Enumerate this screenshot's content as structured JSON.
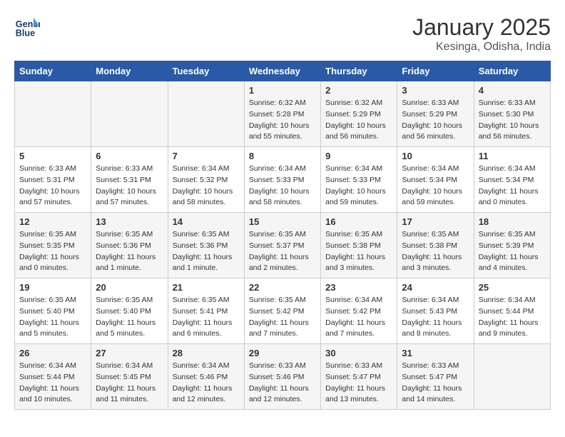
{
  "header": {
    "logo_line1": "General",
    "logo_line2": "Blue",
    "title": "January 2025",
    "subtitle": "Kesinga, Odisha, India"
  },
  "weekdays": [
    "Sunday",
    "Monday",
    "Tuesday",
    "Wednesday",
    "Thursday",
    "Friday",
    "Saturday"
  ],
  "weeks": [
    [
      {
        "day": "",
        "sunrise": "",
        "sunset": "",
        "daylight": ""
      },
      {
        "day": "",
        "sunrise": "",
        "sunset": "",
        "daylight": ""
      },
      {
        "day": "",
        "sunrise": "",
        "sunset": "",
        "daylight": ""
      },
      {
        "day": "1",
        "sunrise": "Sunrise: 6:32 AM",
        "sunset": "Sunset: 5:28 PM",
        "daylight": "Daylight: 10 hours and 55 minutes."
      },
      {
        "day": "2",
        "sunrise": "Sunrise: 6:32 AM",
        "sunset": "Sunset: 5:29 PM",
        "daylight": "Daylight: 10 hours and 56 minutes."
      },
      {
        "day": "3",
        "sunrise": "Sunrise: 6:33 AM",
        "sunset": "Sunset: 5:29 PM",
        "daylight": "Daylight: 10 hours and 56 minutes."
      },
      {
        "day": "4",
        "sunrise": "Sunrise: 6:33 AM",
        "sunset": "Sunset: 5:30 PM",
        "daylight": "Daylight: 10 hours and 56 minutes."
      }
    ],
    [
      {
        "day": "5",
        "sunrise": "Sunrise: 6:33 AM",
        "sunset": "Sunset: 5:31 PM",
        "daylight": "Daylight: 10 hours and 57 minutes."
      },
      {
        "day": "6",
        "sunrise": "Sunrise: 6:33 AM",
        "sunset": "Sunset: 5:31 PM",
        "daylight": "Daylight: 10 hours and 57 minutes."
      },
      {
        "day": "7",
        "sunrise": "Sunrise: 6:34 AM",
        "sunset": "Sunset: 5:32 PM",
        "daylight": "Daylight: 10 hours and 58 minutes."
      },
      {
        "day": "8",
        "sunrise": "Sunrise: 6:34 AM",
        "sunset": "Sunset: 5:33 PM",
        "daylight": "Daylight: 10 hours and 58 minutes."
      },
      {
        "day": "9",
        "sunrise": "Sunrise: 6:34 AM",
        "sunset": "Sunset: 5:33 PM",
        "daylight": "Daylight: 10 hours and 59 minutes."
      },
      {
        "day": "10",
        "sunrise": "Sunrise: 6:34 AM",
        "sunset": "Sunset: 5:34 PM",
        "daylight": "Daylight: 10 hours and 59 minutes."
      },
      {
        "day": "11",
        "sunrise": "Sunrise: 6:34 AM",
        "sunset": "Sunset: 5:34 PM",
        "daylight": "Daylight: 11 hours and 0 minutes."
      }
    ],
    [
      {
        "day": "12",
        "sunrise": "Sunrise: 6:35 AM",
        "sunset": "Sunset: 5:35 PM",
        "daylight": "Daylight: 11 hours and 0 minutes."
      },
      {
        "day": "13",
        "sunrise": "Sunrise: 6:35 AM",
        "sunset": "Sunset: 5:36 PM",
        "daylight": "Daylight: 11 hours and 1 minute."
      },
      {
        "day": "14",
        "sunrise": "Sunrise: 6:35 AM",
        "sunset": "Sunset: 5:36 PM",
        "daylight": "Daylight: 11 hours and 1 minute."
      },
      {
        "day": "15",
        "sunrise": "Sunrise: 6:35 AM",
        "sunset": "Sunset: 5:37 PM",
        "daylight": "Daylight: 11 hours and 2 minutes."
      },
      {
        "day": "16",
        "sunrise": "Sunrise: 6:35 AM",
        "sunset": "Sunset: 5:38 PM",
        "daylight": "Daylight: 11 hours and 3 minutes."
      },
      {
        "day": "17",
        "sunrise": "Sunrise: 6:35 AM",
        "sunset": "Sunset: 5:38 PM",
        "daylight": "Daylight: 11 hours and 3 minutes."
      },
      {
        "day": "18",
        "sunrise": "Sunrise: 6:35 AM",
        "sunset": "Sunset: 5:39 PM",
        "daylight": "Daylight: 11 hours and 4 minutes."
      }
    ],
    [
      {
        "day": "19",
        "sunrise": "Sunrise: 6:35 AM",
        "sunset": "Sunset: 5:40 PM",
        "daylight": "Daylight: 11 hours and 5 minutes."
      },
      {
        "day": "20",
        "sunrise": "Sunrise: 6:35 AM",
        "sunset": "Sunset: 5:40 PM",
        "daylight": "Daylight: 11 hours and 5 minutes."
      },
      {
        "day": "21",
        "sunrise": "Sunrise: 6:35 AM",
        "sunset": "Sunset: 5:41 PM",
        "daylight": "Daylight: 11 hours and 6 minutes."
      },
      {
        "day": "22",
        "sunrise": "Sunrise: 6:35 AM",
        "sunset": "Sunset: 5:42 PM",
        "daylight": "Daylight: 11 hours and 7 minutes."
      },
      {
        "day": "23",
        "sunrise": "Sunrise: 6:34 AM",
        "sunset": "Sunset: 5:42 PM",
        "daylight": "Daylight: 11 hours and 7 minutes."
      },
      {
        "day": "24",
        "sunrise": "Sunrise: 6:34 AM",
        "sunset": "Sunset: 5:43 PM",
        "daylight": "Daylight: 11 hours and 8 minutes."
      },
      {
        "day": "25",
        "sunrise": "Sunrise: 6:34 AM",
        "sunset": "Sunset: 5:44 PM",
        "daylight": "Daylight: 11 hours and 9 minutes."
      }
    ],
    [
      {
        "day": "26",
        "sunrise": "Sunrise: 6:34 AM",
        "sunset": "Sunset: 5:44 PM",
        "daylight": "Daylight: 11 hours and 10 minutes."
      },
      {
        "day": "27",
        "sunrise": "Sunrise: 6:34 AM",
        "sunset": "Sunset: 5:45 PM",
        "daylight": "Daylight: 11 hours and 11 minutes."
      },
      {
        "day": "28",
        "sunrise": "Sunrise: 6:34 AM",
        "sunset": "Sunset: 5:46 PM",
        "daylight": "Daylight: 11 hours and 12 minutes."
      },
      {
        "day": "29",
        "sunrise": "Sunrise: 6:33 AM",
        "sunset": "Sunset: 5:46 PM",
        "daylight": "Daylight: 11 hours and 12 minutes."
      },
      {
        "day": "30",
        "sunrise": "Sunrise: 6:33 AM",
        "sunset": "Sunset: 5:47 PM",
        "daylight": "Daylight: 11 hours and 13 minutes."
      },
      {
        "day": "31",
        "sunrise": "Sunrise: 6:33 AM",
        "sunset": "Sunset: 5:47 PM",
        "daylight": "Daylight: 11 hours and 14 minutes."
      },
      {
        "day": "",
        "sunrise": "",
        "sunset": "",
        "daylight": ""
      }
    ]
  ]
}
